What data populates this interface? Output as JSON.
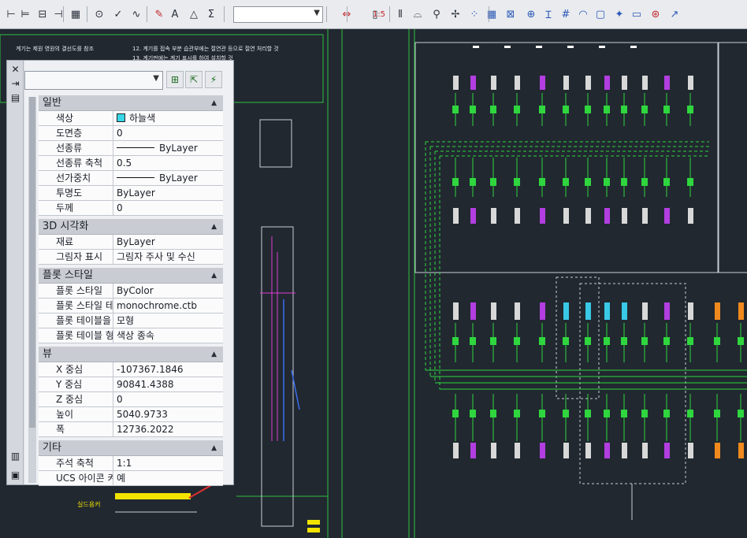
{
  "toolbar": {
    "left_icons": [
      "align-left-icon",
      "align-center-icon",
      "text-frame-icon",
      "align-right-icon",
      "table-icon",
      "circle-icon",
      "check-icon",
      "wave-icon",
      "edit-icon",
      "text-icon",
      "triangle-icon",
      "equation-icon"
    ],
    "combo_value": "",
    "right_icons": [
      "scale-icon",
      "ruler-icon",
      "bars-icon",
      "cylinder-icon",
      "node-icon",
      "snap-icon",
      "point-icon",
      "grid-icon",
      "box-icon",
      "crosshair-icon",
      "text-cursor-icon",
      "hash-icon",
      "arc-icon",
      "square-icon",
      "star-icon",
      "rect-icon",
      "target-icon",
      "arrow-icon"
    ],
    "ratio_label": "1:5"
  },
  "palette": {
    "side_icons": [
      "close-icon",
      "pin-icon",
      "properties-icon"
    ],
    "side_bottom": [
      "quick-props-icon",
      "menu-icon"
    ],
    "selector_value": "",
    "buttons": [
      "pickadd-icon",
      "select-objects-icon",
      "quick-select-icon"
    ],
    "sections": [
      {
        "title": "일반",
        "rows": [
          {
            "label": "색상",
            "value": "하늘색",
            "kind": "color"
          },
          {
            "label": "도면층",
            "value": "0"
          },
          {
            "label": "선종류",
            "value": "ByLayer",
            "kind": "line"
          },
          {
            "label": "선종류 축척",
            "value": "0.5"
          },
          {
            "label": "선가중치",
            "value": "ByLayer",
            "kind": "line"
          },
          {
            "label": "투명도",
            "value": "ByLayer"
          },
          {
            "label": "두께",
            "value": "0"
          }
        ]
      },
      {
        "title": "3D 시각화",
        "rows": [
          {
            "label": "재료",
            "value": "ByLayer"
          },
          {
            "label": "그림자 표시",
            "value": "그림자 주사 및 수신"
          }
        ]
      },
      {
        "title": "플롯 스타일",
        "rows": [
          {
            "label": "플롯 스타일",
            "value": "ByColor"
          },
          {
            "label": "플롯 스타일 테...",
            "value": "monochrome.ctb"
          },
          {
            "label": "플롯 테이블을 ...",
            "value": "모형"
          },
          {
            "label": "플롯 테이블 형...",
            "value": "색상 종속"
          }
        ]
      },
      {
        "title": "뷰",
        "rows": [
          {
            "label": "X 중심",
            "value": "-107367.1846"
          },
          {
            "label": "Y 중심",
            "value": "90841.4388"
          },
          {
            "label": "Z 중심",
            "value": "0"
          },
          {
            "label": "높이",
            "value": "5040.9733"
          },
          {
            "label": "폭",
            "value": "12736.2022"
          }
        ]
      },
      {
        "title": "기타",
        "rows": [
          {
            "label": "주석 축척",
            "value": "1:1"
          },
          {
            "label": "UCS 아이콘 켜기",
            "value": "예"
          }
        ]
      }
    ]
  },
  "drawing": {
    "note_lines": [
      "12. 계기를 접속 부분 습관부에는 절연관 등으로 절연 처리할 것",
      "13. 계기판에는 계기 표시를 하여 설치할 것"
    ],
    "left_label": "계기는 제원 영원의 결선도를 참조",
    "yellow_label": "실드용커"
  }
}
